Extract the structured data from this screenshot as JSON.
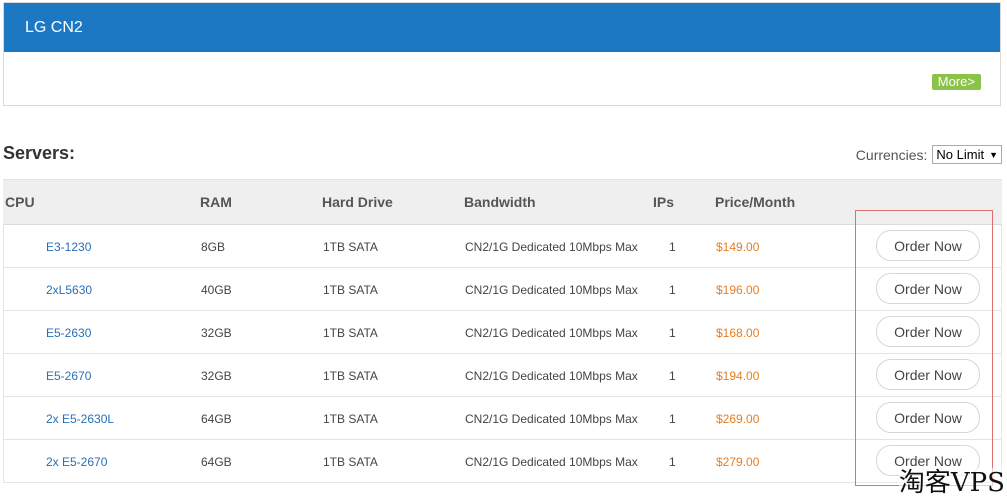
{
  "panel": {
    "title": "LG CN2",
    "more_label": "More>"
  },
  "servers": {
    "title": "Servers:",
    "currencies_label": "Currencies:",
    "currency_selected": "No Limit"
  },
  "table": {
    "headers": {
      "cpu": "CPU",
      "ram": "RAM",
      "hard_drive": "Hard Drive",
      "bandwidth": "Bandwidth",
      "ips": "IPs",
      "price": "Price/Month"
    },
    "rows": [
      {
        "cpu": "E3-1230",
        "ram": "8GB",
        "hd": "1TB SATA",
        "bw": "CN2/1G Dedicated 10Mbps Max",
        "ips": "1",
        "price": "$149.00",
        "order": "Order Now"
      },
      {
        "cpu": "2xL5630",
        "ram": "40GB",
        "hd": "1TB SATA",
        "bw": "CN2/1G Dedicated 10Mbps Max",
        "ips": "1",
        "price": "$196.00",
        "order": "Order Now"
      },
      {
        "cpu": "E5-2630",
        "ram": "32GB",
        "hd": "1TB SATA",
        "bw": "CN2/1G Dedicated 10Mbps Max",
        "ips": "1",
        "price": "$168.00",
        "order": "Order Now"
      },
      {
        "cpu": "E5-2670",
        "ram": "32GB",
        "hd": "1TB SATA",
        "bw": "CN2/1G Dedicated 10Mbps Max",
        "ips": "1",
        "price": "$194.00",
        "order": "Order Now"
      },
      {
        "cpu": "2x E5-2630L",
        "ram": "64GB",
        "hd": "1TB SATA",
        "bw": "CN2/1G Dedicated 10Mbps Max",
        "ips": "1",
        "price": "$269.00",
        "order": "Order Now"
      },
      {
        "cpu": "2x E5-2670",
        "ram": "64GB",
        "hd": "1TB SATA",
        "bw": "CN2/1G Dedicated 10Mbps Max",
        "ips": "1",
        "price": "$279.00",
        "order": "Order Now"
      }
    ]
  },
  "watermark": "淘客VPS",
  "colors": {
    "header_blue": "#1c78c3",
    "more_green": "#8bc34a",
    "price_orange": "#e67e22",
    "link_blue": "#2a6fb5",
    "highlight_red": "#e07070"
  }
}
